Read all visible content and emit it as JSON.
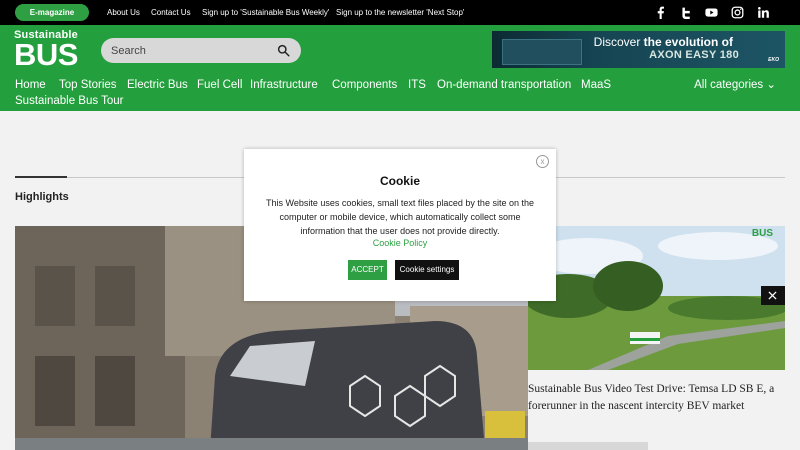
{
  "topbar": {
    "emagazine": "E-magazine",
    "links": [
      "About Us",
      "Contact Us",
      "Sign up to 'Sustainable Bus Weekly'",
      "Sign up to the newsletter 'Next Stop'"
    ],
    "social_icons": [
      "facebook-icon",
      "twitter-icon",
      "youtube-icon",
      "instagram-icon",
      "linkedin-icon"
    ]
  },
  "logo": {
    "line1": "Sustainable",
    "line2": "BUS"
  },
  "search": {
    "placeholder": "Search"
  },
  "banner": {
    "line1_pre": "Discover ",
    "line1_bold": "the evolution of",
    "line2": "AXON EASY 180",
    "brand": "EKO"
  },
  "nav": {
    "items": [
      "Home",
      "Top Stories",
      "Electric Bus",
      "Fuel Cell",
      "Infrastructure",
      "Components",
      "ITS",
      "On-demand transportation",
      "MaaS",
      "Sustainable Bus Tour"
    ],
    "all_categories": "All categories"
  },
  "section": {
    "highlights": "Highlights"
  },
  "article": {
    "title": "Sustainable Bus Video Test Drive: Temsa LD SB E, a forerunner in the nascent intercity BEV market",
    "tag": "BUS"
  },
  "cookie": {
    "close": "x",
    "title": "Cookie",
    "text": "This Website uses cookies, small text files placed by the site on the computer or mobile device, which automatically collect some information that the user does not provide directly.",
    "policy": "Cookie Policy",
    "accept": "ACCEPT",
    "settings": "Cookie settings"
  },
  "colors": {
    "brand_green": "#23a03d",
    "accent_green": "#2ea043",
    "topbar": "#000000"
  }
}
